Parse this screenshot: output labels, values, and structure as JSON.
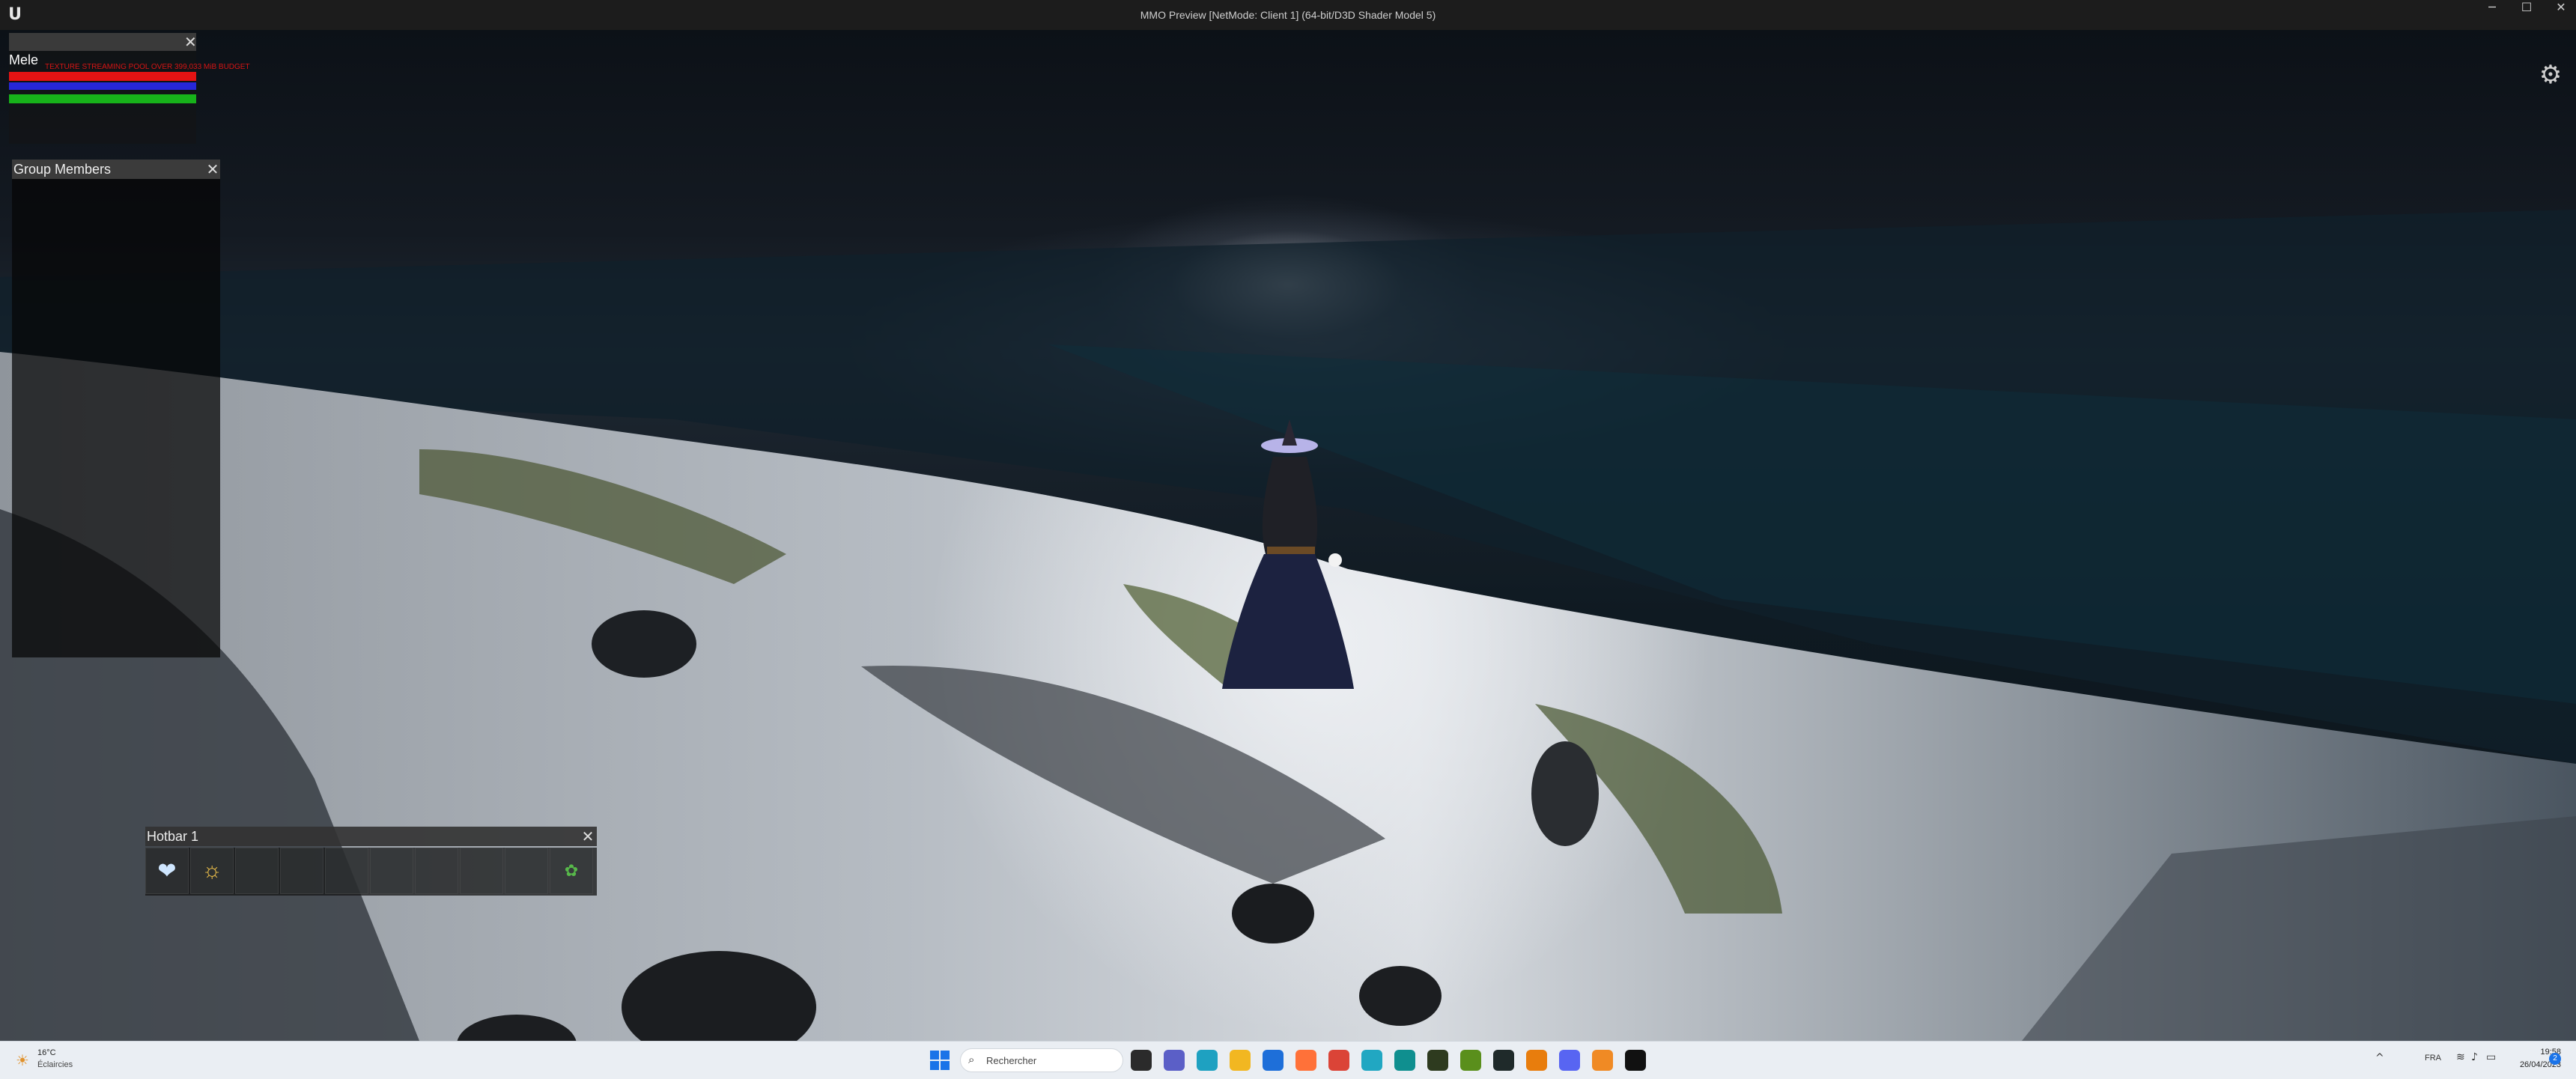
{
  "window": {
    "title": "MMO Preview [NetMode: Client 1]  (64-bit/D3D Shader Model 5)",
    "logo_glyph": "U",
    "minimize_glyph": "─",
    "maximize_glyph": "☐",
    "close_glyph": "✕"
  },
  "hud": {
    "settings_glyph": "⚙",
    "target": {
      "name": "Mele",
      "debug_warning": "TEXTURE STREAMING POOL OVER 399,033 MiB BUDGET",
      "close_glyph": "✕",
      "health_fraction": 1.0,
      "mana_fraction": 1.0,
      "stamina_fraction": 1.0,
      "colors": {
        "health": "#e41313",
        "mana": "#2727d8",
        "stamina": "#17b21a"
      }
    },
    "group": {
      "title": "Group Members",
      "close_glyph": "✕"
    },
    "hotbar": {
      "title": "Hotbar 1",
      "close_glyph": "✕",
      "slots": [
        {
          "icon": "ice-heart-icon",
          "glyph": "❤"
        },
        {
          "icon": "sun-swirl-icon",
          "glyph": "☼"
        },
        {
          "icon": "",
          "glyph": ""
        },
        {
          "icon": "",
          "glyph": ""
        },
        {
          "icon": "",
          "glyph": ""
        },
        {
          "icon": "",
          "glyph": ""
        },
        {
          "icon": "",
          "glyph": ""
        },
        {
          "icon": "",
          "glyph": ""
        },
        {
          "icon": "",
          "glyph": ""
        },
        {
          "icon": "herb-icon",
          "glyph": "✿"
        }
      ]
    }
  },
  "taskbar": {
    "weather_temp": "16°C",
    "weather_desc": "Éclaircies",
    "search_placeholder": "Rechercher",
    "language": "FRA",
    "time": "19:58",
    "date": "26/04/2023",
    "notification_count": "2",
    "pinned_apps": [
      {
        "name": "file-explorer-icon",
        "color": "#2b2b2b"
      },
      {
        "name": "teams-icon",
        "color": "#5b5fc7"
      },
      {
        "name": "edge-icon",
        "color": "#1ea1c1"
      },
      {
        "name": "folder-icon",
        "color": "#f2b721"
      },
      {
        "name": "mail-icon",
        "color": "#1e6fd9"
      },
      {
        "name": "firefox-icon",
        "color": "#ff7139"
      },
      {
        "name": "chrome-icon",
        "color": "#db4437"
      },
      {
        "name": "app-cyan-icon",
        "color": "#21a7c2"
      },
      {
        "name": "app-teal-icon",
        "color": "#0f8f8f"
      },
      {
        "name": "terminal-icon",
        "color": "#2e3b1f"
      },
      {
        "name": "nvidia-icon",
        "color": "#5a8f1c"
      },
      {
        "name": "github-icon",
        "color": "#1f2a2a"
      },
      {
        "name": "blender-icon",
        "color": "#e87d0d"
      },
      {
        "name": "discord-icon",
        "color": "#5865f2"
      },
      {
        "name": "blender-2-icon",
        "color": "#f08a24"
      },
      {
        "name": "unreal-icon",
        "color": "#111111"
      }
    ]
  }
}
